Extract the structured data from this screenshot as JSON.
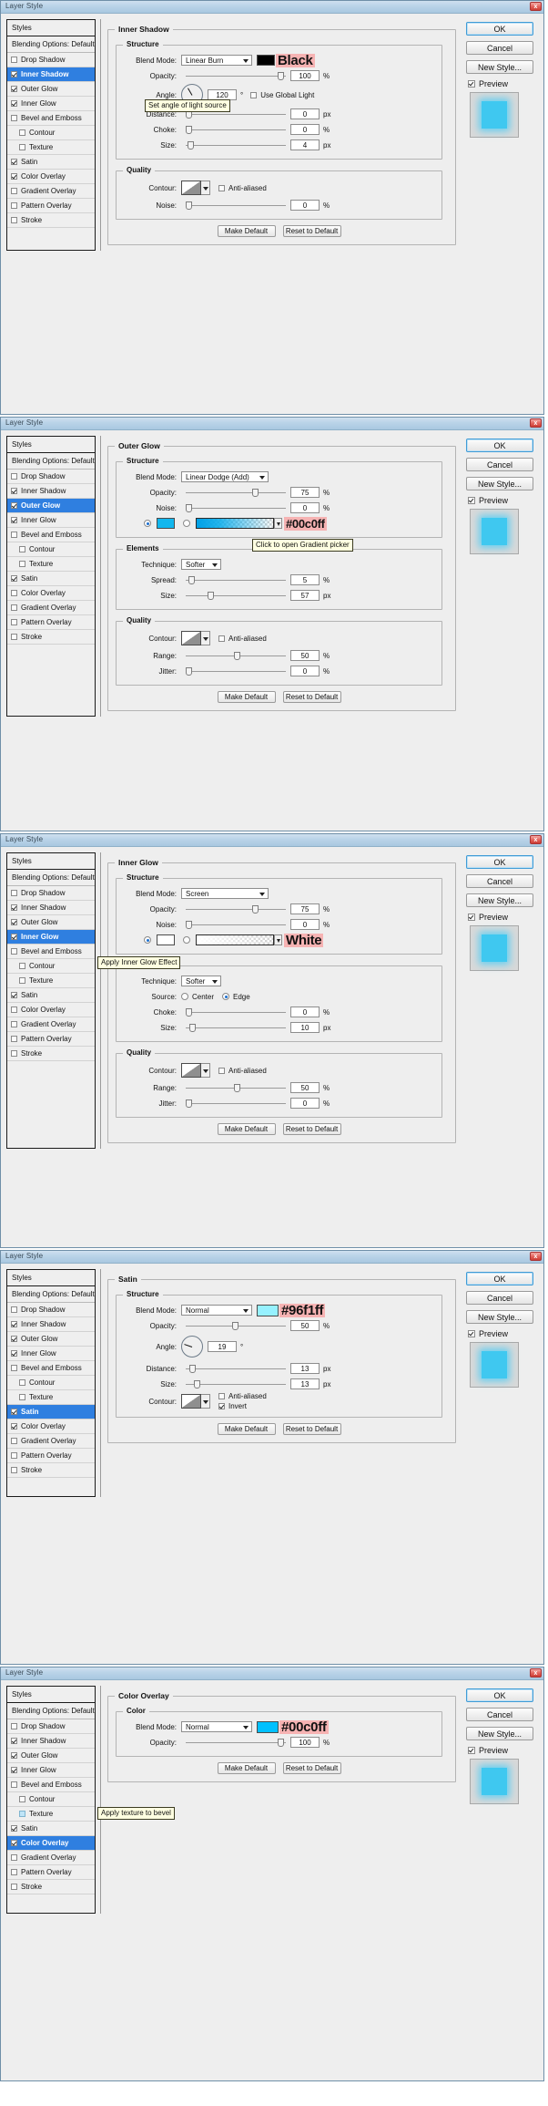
{
  "window": {
    "title": "Layer Style",
    "close_label": "x"
  },
  "styles_list": {
    "header": "Styles",
    "blending_options": "Blending Options: Default",
    "items": [
      "Drop Shadow",
      "Inner Shadow",
      "Outer Glow",
      "Inner Glow",
      "Bevel and Emboss",
      "Contour",
      "Texture",
      "Satin",
      "Color Overlay",
      "Gradient Overlay",
      "Pattern Overlay",
      "Stroke"
    ]
  },
  "buttons": {
    "ok": "OK",
    "cancel": "Cancel",
    "new_style": "New Style...",
    "preview": "Preview",
    "make_default": "Make Default",
    "reset_default": "Reset to Default"
  },
  "labels": {
    "structure": "Structure",
    "quality": "Quality",
    "elements": "Elements",
    "color": "Color",
    "blend_mode": "Blend Mode:",
    "opacity": "Opacity:",
    "angle": "Angle:",
    "distance": "Distance:",
    "choke": "Choke:",
    "size": "Size:",
    "noise": "Noise:",
    "contour": "Contour:",
    "range": "Range:",
    "jitter": "Jitter:",
    "spread": "Spread:",
    "technique": "Technique:",
    "source": "Source:",
    "center": "Center",
    "edge": "Edge",
    "anti_aliased": "Anti-aliased",
    "invert": "Invert",
    "use_global_light": "Use Global Light",
    "unit_px": "px",
    "unit_pct": "%",
    "unit_deg": "°"
  },
  "colors": {
    "accent_blue": "#3fc8f0",
    "selection_blue": "#2f7fe0",
    "tag_bg": "#f6b3b3",
    "satin_swatch": "#96f1ff",
    "overlay_swatch": "#00c0ff",
    "glow_swatch": "#00c0ff"
  },
  "panels": [
    {
      "id": "inner-shadow",
      "section_title": "Inner Shadow",
      "selected_style": "Inner Shadow",
      "checked_styles": [
        "Inner Shadow",
        "Outer Glow",
        "Inner Glow",
        "Satin",
        "Color Overlay"
      ],
      "tooltip": {
        "text": "Set angle of light source"
      },
      "color_tag": "Black",
      "fields": {
        "blend_mode": "Linear Burn",
        "opacity": "100",
        "angle": "120",
        "distance": "0",
        "choke": "0",
        "size": "4",
        "noise": "0"
      }
    },
    {
      "id": "outer-glow",
      "section_title": "Outer Glow",
      "selected_style": "Outer Glow",
      "checked_styles": [
        "Inner Shadow",
        "Outer Glow",
        "Inner Glow",
        "Satin",
        "Color Overlay"
      ],
      "tooltip": {
        "text": "Click to open Gradient picker"
      },
      "color_tag": "#00c0ff",
      "fields": {
        "blend_mode": "Linear Dodge (Add)",
        "opacity": "75",
        "noise": "0",
        "technique": "Softer",
        "spread": "5",
        "size": "57",
        "range": "50",
        "jitter": "0"
      }
    },
    {
      "id": "inner-glow",
      "section_title": "Inner Glow",
      "selected_style": "Inner Glow",
      "checked_styles": [
        "Inner Shadow",
        "Outer Glow",
        "Inner Glow",
        "Satin",
        "Color Overlay"
      ],
      "tooltip": {
        "text": "Apply Inner Glow Effect"
      },
      "color_tag": "White",
      "fields": {
        "blend_mode": "Screen",
        "opacity": "75",
        "noise": "0",
        "technique": "Softer",
        "source": "Edge",
        "choke": "0",
        "size": "10",
        "range": "50",
        "jitter": "0"
      }
    },
    {
      "id": "satin",
      "section_title": "Satin",
      "selected_style": "Satin",
      "checked_styles": [
        "Inner Shadow",
        "Outer Glow",
        "Inner Glow",
        "Satin",
        "Color Overlay"
      ],
      "tooltip": null,
      "color_tag": "#96f1ff",
      "fields": {
        "blend_mode": "Normal",
        "opacity": "50",
        "angle": "19",
        "distance": "13",
        "size": "13",
        "invert_checked": "true"
      }
    },
    {
      "id": "color-overlay",
      "section_title": "Color Overlay",
      "selected_style": "Color Overlay",
      "checked_styles": [
        "Inner Shadow",
        "Outer Glow",
        "Inner Glow",
        "Satin",
        "Color Overlay"
      ],
      "tooltip": {
        "text": "Apply texture to bevel"
      },
      "color_tag": "#00c0ff",
      "fields": {
        "blend_mode": "Normal",
        "opacity": "100"
      }
    }
  ]
}
